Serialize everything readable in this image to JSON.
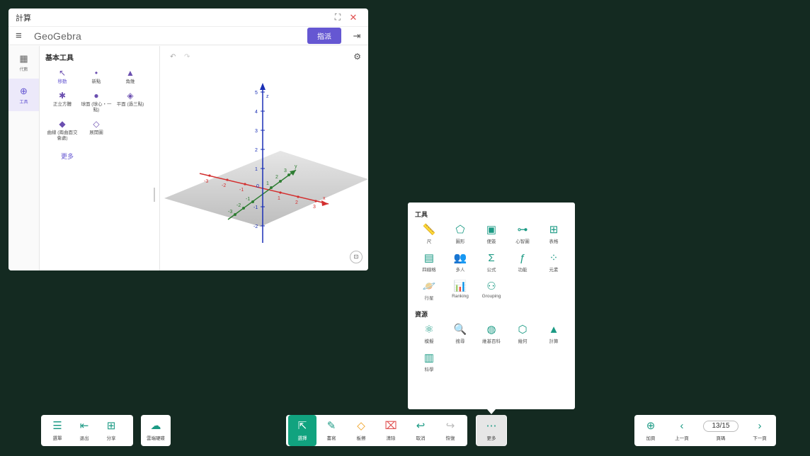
{
  "window": {
    "title": "計算",
    "maximize_icon": "⛶",
    "close_icon": "✕"
  },
  "app": {
    "brand": "GeoGebra",
    "assign_label": "指派",
    "menu_icon": "≡",
    "signin_icon": "⇥"
  },
  "rail": [
    {
      "icon": "▦",
      "label": "代數"
    },
    {
      "icon": "⊕",
      "label": "工具"
    }
  ],
  "tools_panel": {
    "heading": "基本工具",
    "tools": [
      {
        "icon": "↖",
        "label": "移動"
      },
      {
        "icon": "•",
        "label": "新點"
      },
      {
        "icon": "▲",
        "label": "角錐"
      },
      {
        "icon": "✱",
        "label": "正立方體"
      },
      {
        "icon": "●",
        "label": "球面 (球心・一點)"
      },
      {
        "icon": "◈",
        "label": "平面 (過三點)"
      },
      {
        "icon": "◆",
        "label": "曲線 (兩曲面交會處)"
      },
      {
        "icon": "◇",
        "label": "展開圖"
      }
    ],
    "more_label": "更多"
  },
  "graphics": {
    "undo_icon": "↶",
    "redo_icon": "↷",
    "settings_icon": "⚙",
    "view_icon": "⊡",
    "axis_z": "z",
    "axis_y": "y",
    "axis_x": "x",
    "z_ticks": [
      "5",
      "4",
      "3",
      "2",
      "1",
      "0",
      "-1",
      "-2"
    ],
    "x_ticks": [
      "-3",
      "-2",
      "-1",
      "1",
      "2",
      "3"
    ],
    "y_ticks": [
      "-3",
      "-2",
      "-1",
      "1",
      "2",
      "3"
    ]
  },
  "popup": {
    "tools_heading": "工具",
    "tools": [
      {
        "icon": "📏",
        "label": "尺"
      },
      {
        "icon": "⬠",
        "label": "圖形"
      },
      {
        "icon": "▣",
        "label": "便簽"
      },
      {
        "icon": "⊶",
        "label": "心智圖"
      },
      {
        "icon": "⊞",
        "label": "表格"
      },
      {
        "icon": "▤",
        "label": "四線格"
      },
      {
        "icon": "👥",
        "label": "多人"
      },
      {
        "icon": "Σ",
        "label": "公式"
      },
      {
        "icon": "ƒ",
        "label": "功能"
      },
      {
        "icon": "⁘",
        "label": "元素"
      },
      {
        "icon": "🪐",
        "label": "行星"
      },
      {
        "icon": "📊",
        "label": "Ranking"
      },
      {
        "icon": "⚇",
        "label": "Grouping"
      }
    ],
    "resources_heading": "資源",
    "resources": [
      {
        "icon": "⚛",
        "label": "模擬"
      },
      {
        "icon": "🔍",
        "label": "搜尋"
      },
      {
        "icon": "◍",
        "label": "維基百科"
      },
      {
        "icon": "⬡",
        "label": "幾何"
      },
      {
        "icon": "▲",
        "label": "計算"
      },
      {
        "icon": "▥",
        "label": "科學"
      }
    ]
  },
  "left_bar": [
    {
      "icon": "☰",
      "label": "選單"
    },
    {
      "icon": "⇤",
      "label": "退出"
    },
    {
      "icon": "⊞",
      "label": "分享"
    }
  ],
  "cloud_bar": {
    "icon": "☁",
    "label": "雲端硬碟"
  },
  "center_bar": [
    {
      "icon": "⇱",
      "label": "選擇",
      "state": "active"
    },
    {
      "icon": "✎",
      "label": "書寫",
      "state": "normal"
    },
    {
      "icon": "◇",
      "label": "板擦",
      "state": "normal"
    },
    {
      "icon": "⌧",
      "label": "清除",
      "state": "normal"
    },
    {
      "icon": "↩",
      "label": "取消",
      "state": "normal"
    },
    {
      "icon": "↪",
      "label": "恢復",
      "state": "disabled"
    }
  ],
  "more_button": {
    "icon": "⋯",
    "label": "更多"
  },
  "page_bar": {
    "add": {
      "icon": "⊕",
      "label": "加頁"
    },
    "prev": {
      "icon": "‹",
      "label": "上一頁"
    },
    "page_value": "13/15",
    "page_label": "頁碼",
    "next": {
      "icon": "›",
      "label": "下一頁"
    }
  },
  "colors": {
    "background": "#142a21",
    "accent": "#1b9a84",
    "active_tool": "#11a37f",
    "geogebra_purple": "#6557d2",
    "x_axis": "#d32f2f",
    "y_axis": "#2e7d32",
    "z_axis": "#1a2fb5"
  }
}
